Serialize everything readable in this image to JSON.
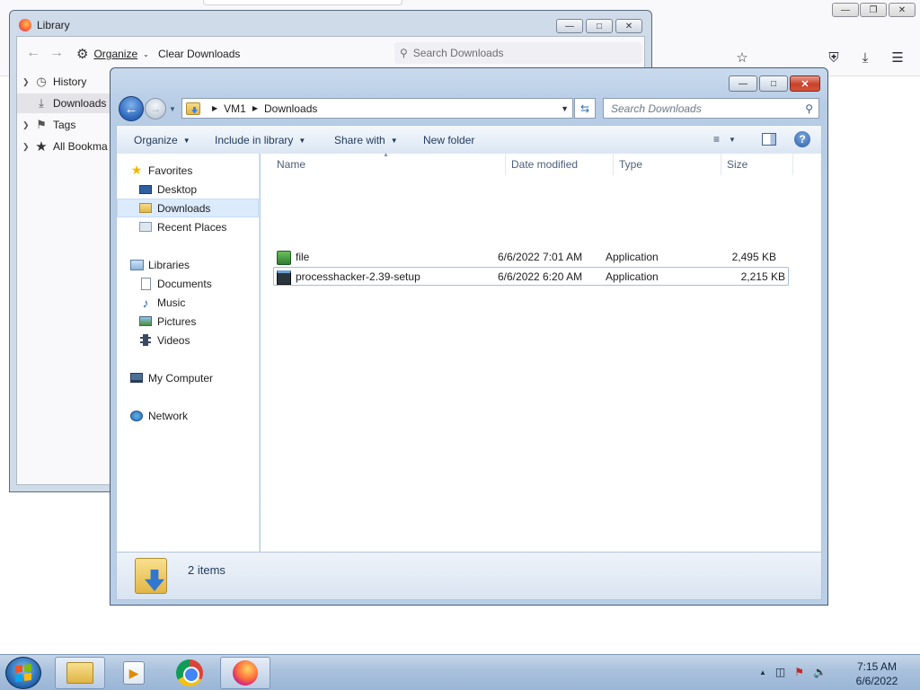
{
  "firefox": {
    "caption_buttons": [
      "minimize",
      "restore",
      "close"
    ]
  },
  "library": {
    "title": "Library",
    "organize_label": "Organize",
    "clear_downloads_label": "Clear Downloads",
    "search_placeholder": "Search Downloads",
    "tree": [
      {
        "label": "History",
        "icon": "clock-icon",
        "selected": false
      },
      {
        "label": "Downloads",
        "icon": "download-icon",
        "selected": true
      },
      {
        "label": "Tags",
        "icon": "tag-icon",
        "selected": false
      },
      {
        "label": "All Bookma",
        "icon": "star-icon",
        "selected": false
      }
    ]
  },
  "explorer": {
    "breadcrumb": [
      "VM1",
      "Downloads"
    ],
    "search_placeholder": "Search Downloads",
    "commands": {
      "organize": "Organize",
      "include_in_library": "Include in library",
      "share_with": "Share with",
      "new_folder": "New folder"
    },
    "nav": {
      "favorites": "Favorites",
      "desktop": "Desktop",
      "downloads": "Downloads",
      "recent_places": "Recent Places",
      "libraries": "Libraries",
      "documents": "Documents",
      "music": "Music",
      "pictures": "Pictures",
      "videos": "Videos",
      "my_computer": "My Computer",
      "network": "Network"
    },
    "columns": {
      "name": "Name",
      "date_modified": "Date modified",
      "type": "Type",
      "size": "Size"
    },
    "files": [
      {
        "name": "file",
        "date_modified": "6/6/2022 7:01 AM",
        "type": "Application",
        "size": "2,495 KB",
        "icon": "installer-icon"
      },
      {
        "name": "processhacker-2.39-setup",
        "date_modified": "6/6/2022 6:20 AM",
        "type": "Application",
        "size": "2,215 KB",
        "icon": "app-icon"
      }
    ],
    "status": "2 items"
  },
  "taskbar": {
    "time": "7:15 AM",
    "date": "6/6/2022"
  },
  "colors": {
    "explorer_frame": "#b9cfe7",
    "selection": "#dcebfc",
    "taskbar": "#a9c1dd"
  }
}
